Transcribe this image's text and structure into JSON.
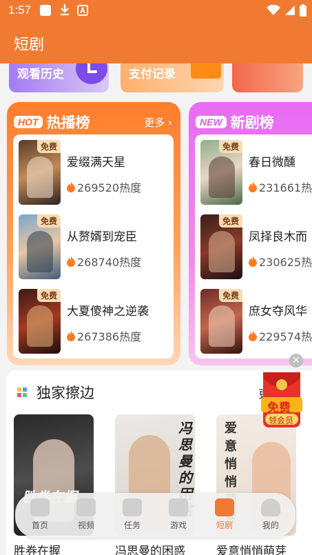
{
  "status_bar": {
    "time": "1:57"
  },
  "app_bar": {
    "title": "短剧"
  },
  "top_cards": [
    {
      "label": "观看历史"
    },
    {
      "label": "支付记录"
    },
    {
      "label": ""
    }
  ],
  "hot_rank": {
    "tag": "HOT",
    "title": "热播榜",
    "more": "更多",
    "items": [
      {
        "badge": "免费",
        "name": "爱缀满天星",
        "heat": "269520热度"
      },
      {
        "badge": "免费",
        "name": "从赘婿到宠臣",
        "heat": "268740热度"
      },
      {
        "badge": "免费",
        "name": "大夏傻神之逆袭",
        "heat": "267386热度"
      }
    ]
  },
  "new_rank": {
    "tag": "NEW",
    "title": "新剧榜",
    "items": [
      {
        "badge": "免费",
        "name": "春日微醺",
        "heat": "231661热"
      },
      {
        "badge": "免费",
        "name": "凤择良木而",
        "heat": "230625热"
      },
      {
        "badge": "免费",
        "name": "庶女夺风华",
        "heat": "229574热"
      }
    ]
  },
  "exclusive": {
    "title": "独家擦边",
    "more": "更",
    "items": [
      {
        "name": "胜券在握",
        "cover_text": "胜券在握"
      },
      {
        "name": "冯思曼的困惑",
        "cover_text": "冯思曼的困惑"
      },
      {
        "name": "爱意悄悄萌芽",
        "cover_text": "爱意悄悄萌芽"
      }
    ]
  },
  "red_packet": {
    "top": "免费",
    "bottom": "领会员"
  },
  "tab_bar": {
    "tabs": [
      {
        "label": "首页"
      },
      {
        "label": "视频"
      },
      {
        "label": "任务"
      },
      {
        "label": "游戏"
      },
      {
        "label": "短剧"
      },
      {
        "label": "我的"
      }
    ],
    "active": "短剧"
  },
  "colors": {
    "accent": "#f07a31",
    "hot_gradient_top": "#ff7d2c",
    "new_gradient_top": "#e86bf5"
  }
}
